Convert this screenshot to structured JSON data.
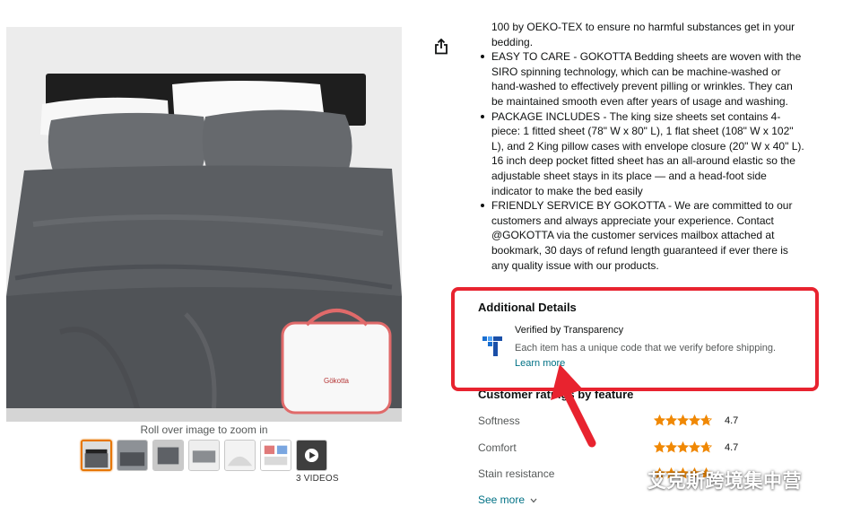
{
  "gallery": {
    "zoom_hint": "Roll over image to zoom in",
    "videos_label": "3 VIDEOS",
    "bag_brand": "Gökotta",
    "thumbnails": [
      "thumb-1",
      "thumb-2",
      "thumb-3",
      "thumb-4",
      "thumb-5",
      "thumb-6",
      "thumb-video"
    ]
  },
  "bullets": {
    "continued": "100 by OEKO-TEX to ensure no harmful substances get in your bedding.",
    "items": [
      "EASY TO CARE - GOKOTTA Bedding sheets are woven with the SIRO spinning technology, which can be machine-washed or hand-washed to effectively prevent pilling or wrinkles. They can be maintained smooth even after years of usage and washing.",
      "PACKAGE INCLUDES - The king size sheets set contains 4-piece: 1 fitted sheet (78\" W x 80\" L), 1 flat sheet (108\" W x 102\" L), and 2 King pillow cases with envelope closure (20\" W x 40\" L). 16 inch deep pocket fitted sheet has an all-around elastic so the adjustable sheet stays in its place — and a head-foot side indicator to make the bed easily",
      "FRIENDLY SERVICE BY GOKOTTA - We are committed to our customers and always appreciate your experience. Contact @GOKOTTA via the customer services mailbox attached at bookmark, 30 days of refund length guaranteed if ever there is any quality issue with our products."
    ]
  },
  "details": {
    "title": "Additional Details",
    "transparency_title": "Verified by Transparency",
    "transparency_desc": "Each item has a unique code that we verify before shipping.",
    "learn_more": "Learn more"
  },
  "ratings": {
    "title": "Customer ratings by feature",
    "rows": [
      {
        "label": "Softness",
        "score": "4.7",
        "stars": 4.7
      },
      {
        "label": "Comfort",
        "score": "4.7",
        "stars": 4.7
      },
      {
        "label": "Stain resistance",
        "score": "",
        "stars": 4.6
      }
    ],
    "see_more": "See more"
  },
  "watermark": {
    "text": "艾克斯跨境集中营"
  },
  "colors": {
    "star": "#f08804",
    "link": "#007185",
    "highlight": "#e8232f",
    "sheet": "#5b5e62"
  },
  "icons": [
    "share-icon",
    "transparency-logo-icon",
    "chevron-down-icon",
    "play-icon",
    "wechat-icon",
    "red-arrow-icon"
  ]
}
